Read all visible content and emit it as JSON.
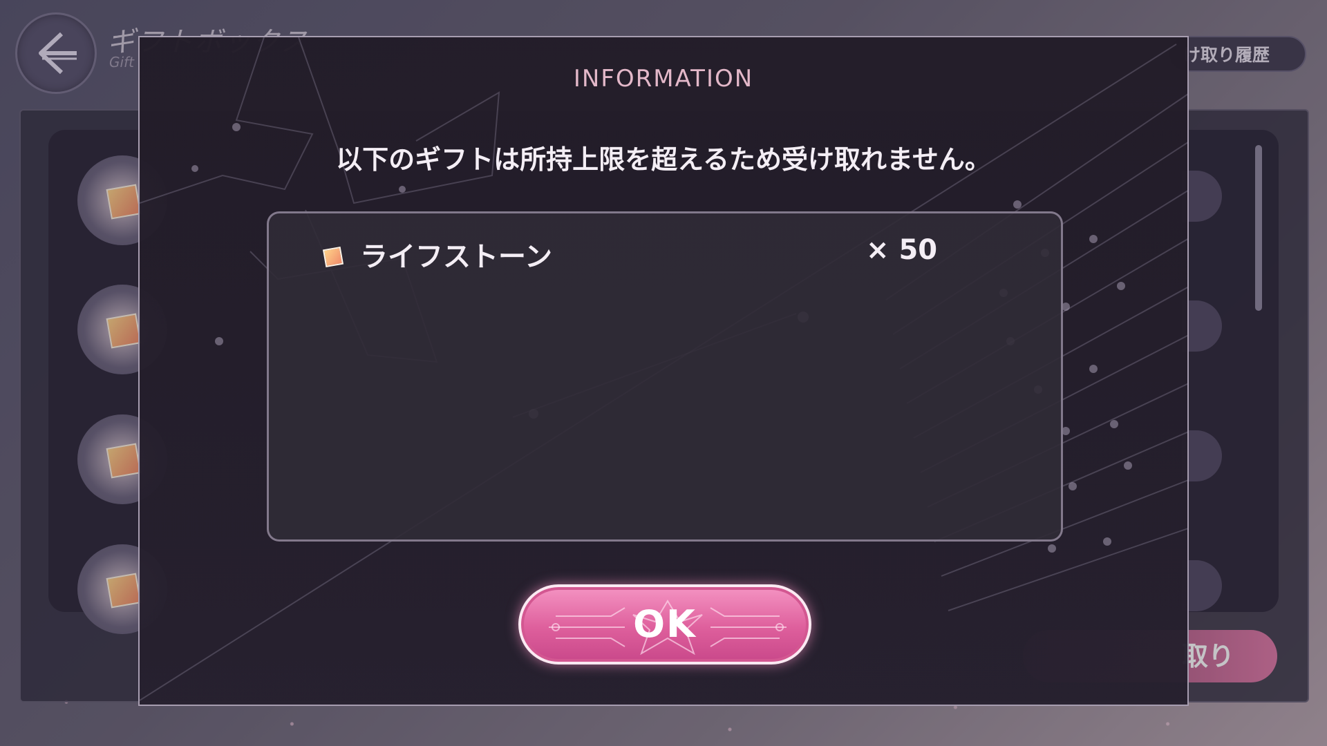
{
  "background_page": {
    "title": "ギフトボックス",
    "subtitle": "Gift",
    "history_button_label": "け取り履歴",
    "receive_button_label": "取り"
  },
  "dialog": {
    "title": "INFORMATION",
    "message": "以下のギフトは所持上限を超えるため受け取れません。",
    "items": [
      {
        "name": "ライフストーン",
        "quantity": "× 50",
        "icon": "lifestone-icon"
      }
    ],
    "ok_label": "OK"
  },
  "colors": {
    "accent_pink": "#de5f9c",
    "title_pink": "#e3b8c9",
    "modal_bg": "#221c28"
  }
}
